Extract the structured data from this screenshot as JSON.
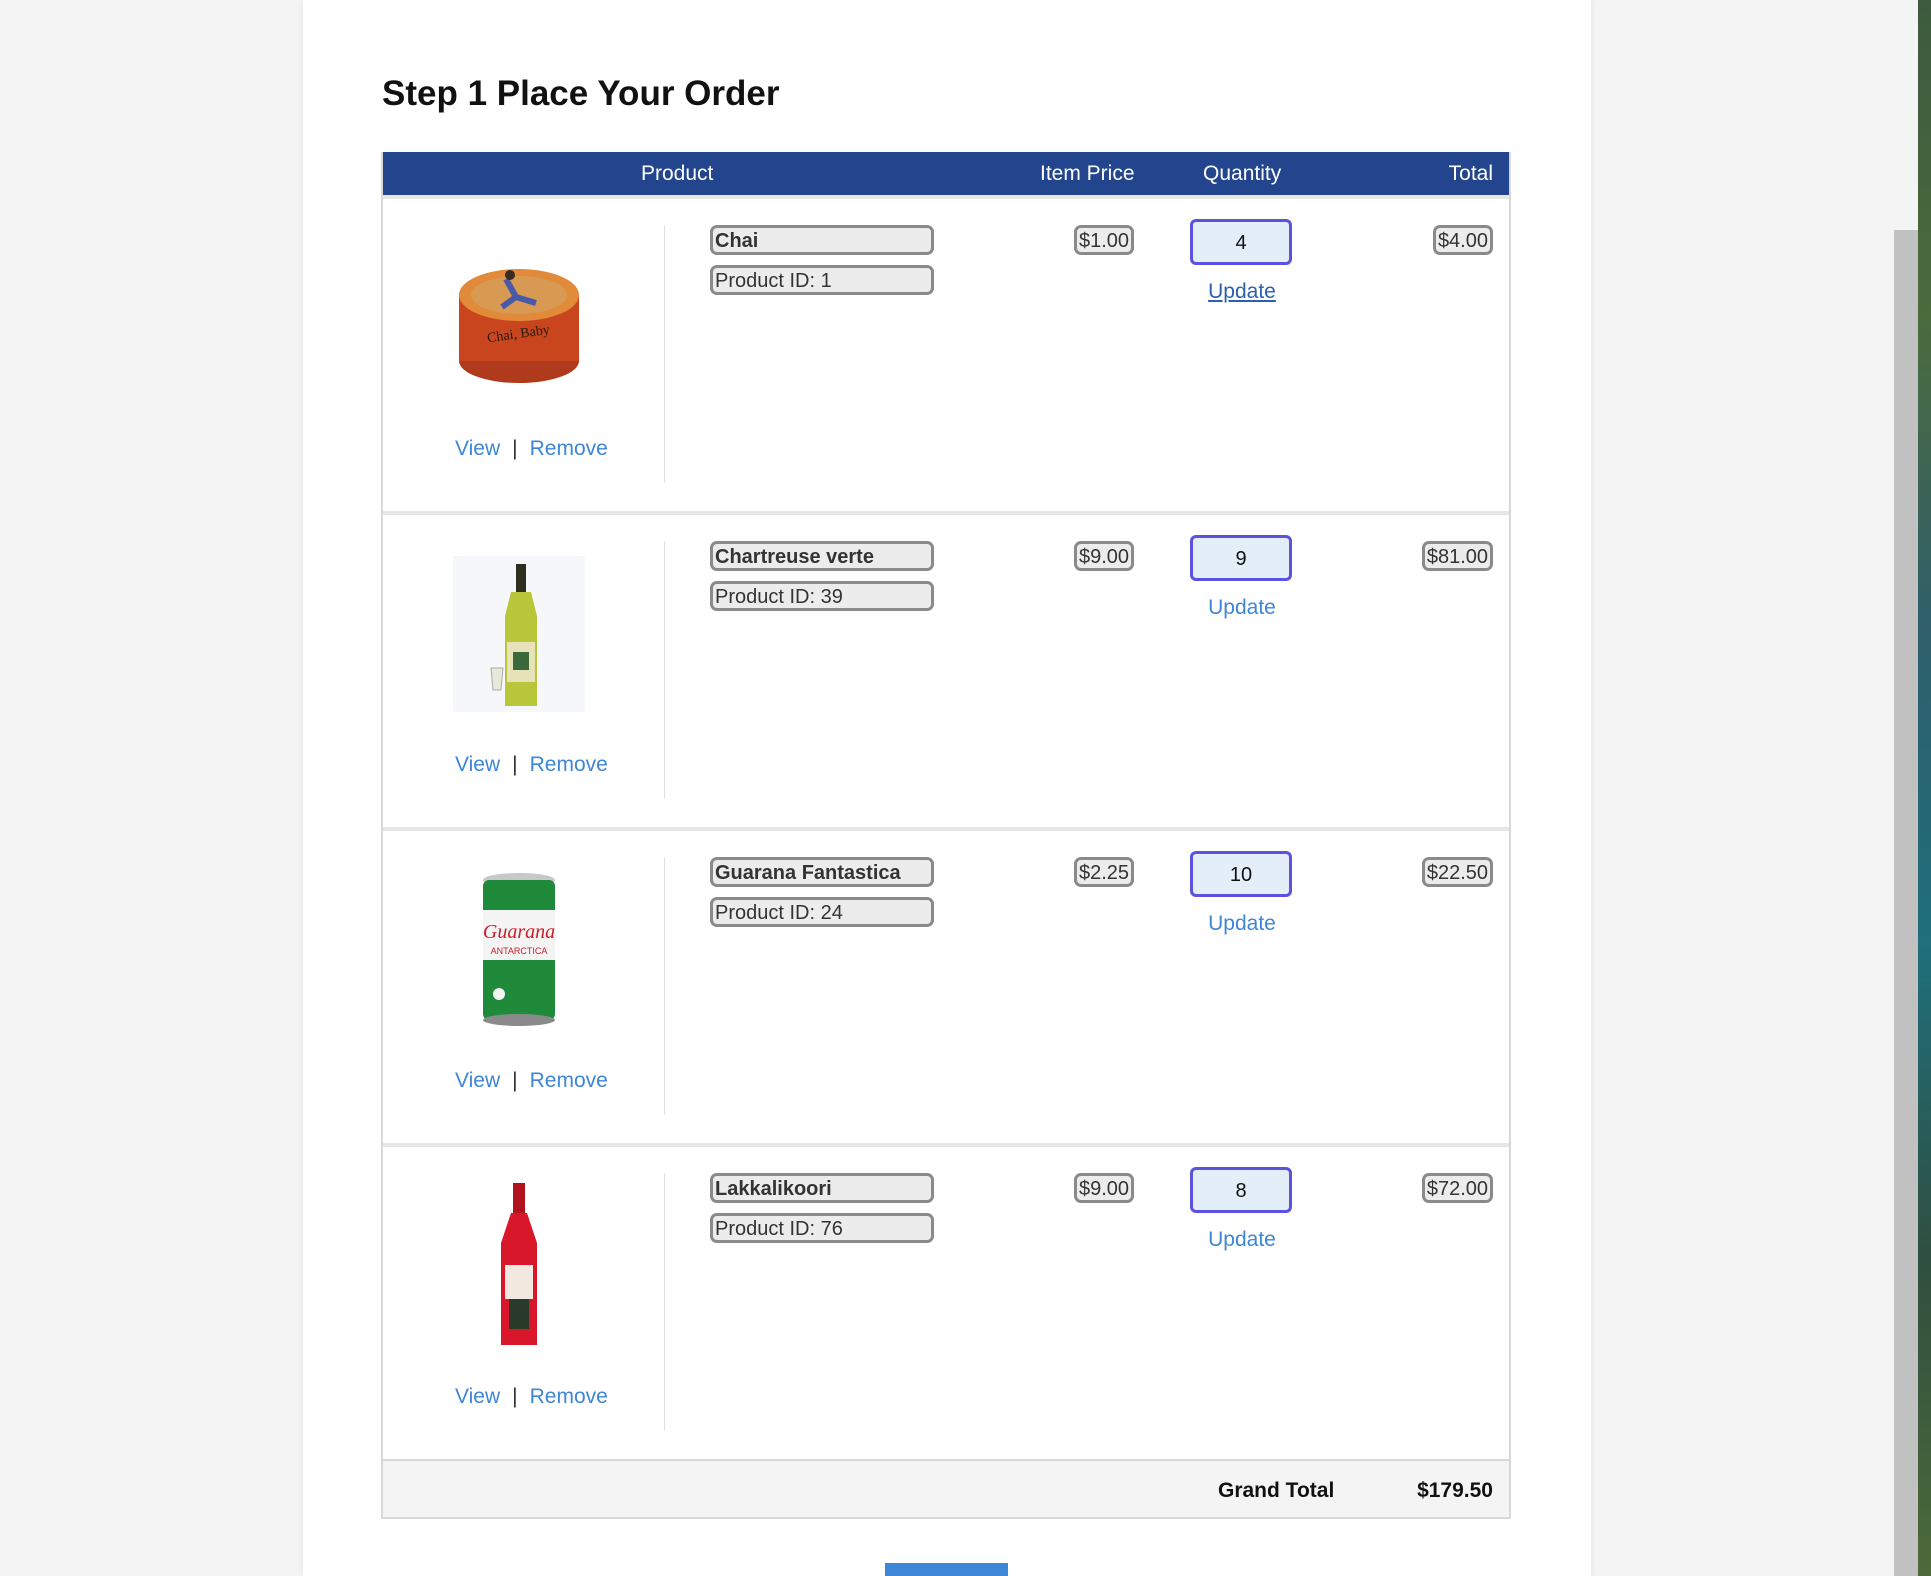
{
  "page": {
    "title": "Step 1 Place Your Order",
    "accent_color": "#22458e",
    "link_color": "#3d86d8"
  },
  "table": {
    "headers": {
      "product": "Product",
      "item_price": "Item Price",
      "quantity": "Quantity",
      "total": "Total"
    },
    "rows": [
      {
        "name": "Chai",
        "product_id": "Product ID: 1",
        "price": "$1.00",
        "quantity": "4",
        "total": "$4.00",
        "view": "View",
        "sep": "|",
        "remove": "Remove",
        "update": "Update",
        "image": "chai-tin-icon"
      },
      {
        "name": "Chartreuse verte",
        "product_id": "Product ID: 39",
        "price": "$9.00",
        "quantity": "9",
        "total": "$81.00",
        "view": "View",
        "sep": "|",
        "remove": "Remove",
        "update": "Update",
        "image": "green-liqueur-bottle-icon"
      },
      {
        "name": "Guarana Fantastica",
        "product_id": "Product ID: 24",
        "price": "$2.25",
        "quantity": "10",
        "total": "$22.50",
        "view": "View",
        "sep": "|",
        "remove": "Remove",
        "update": "Update",
        "image": "soda-can-icon"
      },
      {
        "name": "Lakkalikoori",
        "product_id": "Product ID: 76",
        "price": "$9.00",
        "quantity": "8",
        "total": "$72.00",
        "view": "View",
        "sep": "|",
        "remove": "Remove",
        "update": "Update",
        "image": "red-liqueur-bottle-icon"
      }
    ],
    "grand_total_label": "Grand Total",
    "grand_total_value": "$179.50"
  }
}
